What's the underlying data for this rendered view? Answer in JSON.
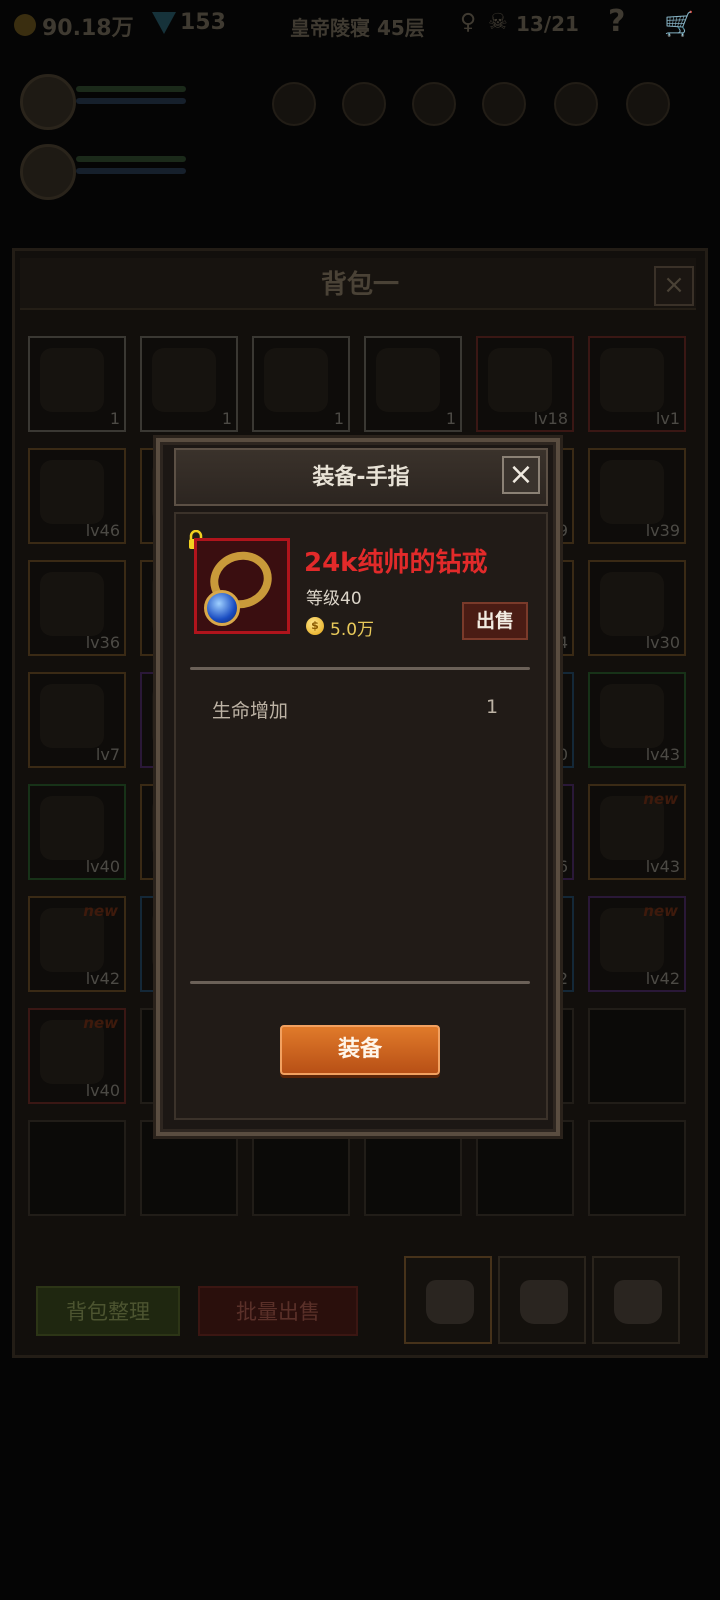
{
  "hud": {
    "gold": "90.18万",
    "gems": "153",
    "tower": "皇帝陵寝 45层",
    "kills": "13/21"
  },
  "backpack": {
    "title": "背包一",
    "sort_label": "背包整理",
    "bulk_sell_label": "批量出售",
    "items": [
      {
        "lv": "1",
        "q": "white"
      },
      {
        "lv": "1",
        "q": "white"
      },
      {
        "lv": "1",
        "q": "white"
      },
      {
        "lv": "1",
        "q": "white"
      },
      {
        "lv": "lv18",
        "q": "red"
      },
      {
        "lv": "lv1",
        "q": "red"
      },
      {
        "lv": "lv46",
        "q": "orange"
      },
      {
        "lv": "",
        "q": "orange"
      },
      {
        "lv": "",
        "q": "orange"
      },
      {
        "lv": "",
        "q": "orange"
      },
      {
        "lv": "9",
        "q": "orange"
      },
      {
        "lv": "lv39",
        "q": "orange"
      },
      {
        "lv": "lv36",
        "q": "orange"
      },
      {
        "lv": "",
        "q": "orange"
      },
      {
        "lv": "",
        "q": "orange"
      },
      {
        "lv": "",
        "q": "orange"
      },
      {
        "lv": "4",
        "q": "orange"
      },
      {
        "lv": "lv30",
        "q": "orange"
      },
      {
        "lv": "lv7",
        "q": "orange"
      },
      {
        "lv": "",
        "q": "purple"
      },
      {
        "lv": "",
        "q": "orange"
      },
      {
        "lv": "",
        "q": "orange"
      },
      {
        "lv": "0",
        "q": "blue"
      },
      {
        "lv": "lv43",
        "q": "green"
      },
      {
        "lv": "lv40",
        "q": "green"
      },
      {
        "lv": "",
        "q": "orange"
      },
      {
        "lv": "",
        "q": "orange"
      },
      {
        "lv": "",
        "q": "orange"
      },
      {
        "lv": "6",
        "q": "purple"
      },
      {
        "lv": "lv43",
        "q": "orange"
      },
      {
        "lv": "lv42",
        "q": "orange"
      },
      {
        "lv": "",
        "q": "blue"
      },
      {
        "lv": "",
        "q": "orange"
      },
      {
        "lv": "",
        "q": "orange"
      },
      {
        "lv": "2",
        "q": "blue"
      },
      {
        "lv": "lv42",
        "q": "purple"
      },
      {
        "lv": "lv40",
        "q": "red"
      },
      {
        "lv": "",
        "q": "empty"
      },
      {
        "lv": "",
        "q": "empty"
      },
      {
        "lv": "",
        "q": "empty"
      },
      {
        "lv": "",
        "q": "empty"
      },
      {
        "lv": "",
        "q": "empty"
      },
      {
        "lv": "",
        "q": "empty"
      },
      {
        "lv": "",
        "q": "empty"
      },
      {
        "lv": "",
        "q": "empty"
      },
      {
        "lv": "",
        "q": "empty"
      },
      {
        "lv": "",
        "q": "empty"
      },
      {
        "lv": "",
        "q": "empty"
      }
    ],
    "new_tag": "new"
  },
  "dialog": {
    "title": "装备-手指",
    "item_name": "24k纯帅的钻戒",
    "item_level": "等级40",
    "price": "5.0万",
    "sell_label": "出售",
    "stats": [
      {
        "name": "生命增加",
        "value": "1"
      }
    ],
    "equip_label": "装备"
  },
  "colors": {
    "item_name": "#e22a2a",
    "equip_button": "#d0662a",
    "quality_red": "#b0141c"
  }
}
